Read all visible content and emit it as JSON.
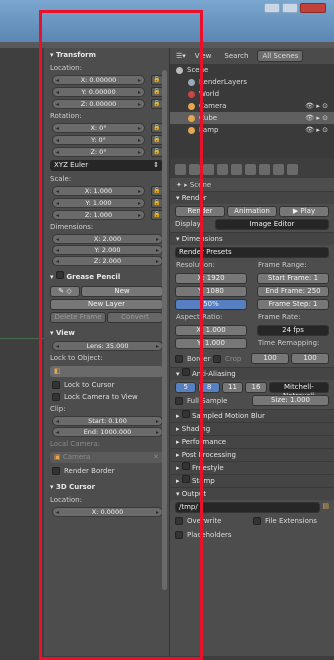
{
  "colors": {
    "highlight": "#e8102a",
    "panel_bg": "#4d4d4d",
    "field_bg": "#6a6a6a",
    "accent_blue": "#5680c2"
  },
  "toolpanel": {
    "transform_header": "Transform",
    "location_label": "Location:",
    "location": [
      "X: 0.00000",
      "Y: 0.00000",
      "Z: 0.00000"
    ],
    "rotation_label": "Rotation:",
    "rotation": [
      "X: 0°",
      "Y: 0°",
      "Z: 0°"
    ],
    "rotation_mode": "XYZ Euler",
    "scale_label": "Scale:",
    "scale": [
      "X: 1.000",
      "Y: 1.000",
      "Z: 1.000"
    ],
    "dimensions_label": "Dimensions:",
    "dimensions": [
      "X: 2.000",
      "Y: 2.000",
      "Z: 2.000"
    ],
    "grease_header": "Grease Pencil",
    "new_label": "New",
    "new_layer_label": "New Layer",
    "delete_frame_label": "Delete Frame",
    "convert_label": "Convert",
    "view_header": "View",
    "lens": "Lens: 35.000",
    "lock_to_object": "Lock to Object:",
    "lock_to_cursor": "Lock to Cursor",
    "lock_camera": "Lock Camera to View",
    "clip_label": "Clip:",
    "clip_start": "Start: 0.100",
    "clip_end": "End: 1000.000",
    "local_camera": "Local Camera:",
    "camera_value": "Camera",
    "render_border": "Render Border",
    "cursor_header": "3D Cursor",
    "cursor_location": "Location:",
    "cursor_x": "X: 0.0000"
  },
  "outliner": {
    "tabs": [
      "View",
      "Search",
      "All Scenes"
    ],
    "items": [
      {
        "label": "Scene"
      },
      {
        "label": "RenderLayers"
      },
      {
        "label": "World"
      },
      {
        "label": "Camera"
      },
      {
        "label": "Cube"
      },
      {
        "label": "Lamp"
      }
    ]
  },
  "properties": {
    "scene_label": "Scene",
    "render_header": "Render",
    "render_btn": "Render",
    "animation_btn": "Animation",
    "play_btn": "Play",
    "display_label": "Display:",
    "display_value": "Image Editor",
    "dimensions_header": "Dimensions",
    "render_presets": "Render Presets",
    "resolution_label": "Resolution:",
    "frame_range_label": "Frame Range:",
    "res_x": "X: 1920",
    "res_y": "Y: 1080",
    "res_pct": "50%",
    "start_frame": "Start Frame: 1",
    "end_frame": "End Frame: 250",
    "frame_step": "Frame Step: 1",
    "aspect_label": "Aspect Ratio:",
    "frame_rate_label": "Frame Rate:",
    "aspect_x": "X: 1.000",
    "aspect_y": "Y: 1.000",
    "fps": "24 fps",
    "time_remap": "Time Remapping:",
    "border": "Border",
    "crop": "Crop",
    "remap_old": "100",
    "remap_new": "100",
    "aa_header": "Anti-Aliasing",
    "aa_samples": [
      "5",
      "8",
      "11",
      "16"
    ],
    "aa_filter": "Mitchell-Netravali",
    "full_sample": "Full Sample",
    "aa_size": "Size: 1.000",
    "sampled_mb": "Sampled Motion Blur",
    "shading": "Shading",
    "performance": "Performance",
    "post_processing": "Post Processing",
    "freestyle": "Freestyle",
    "stamp": "Stamp",
    "output": "Output",
    "output_path": "/tmp/",
    "overwrite": "Overwrite",
    "file_extensions": "File Extensions",
    "placeholders": "Placeholders"
  }
}
